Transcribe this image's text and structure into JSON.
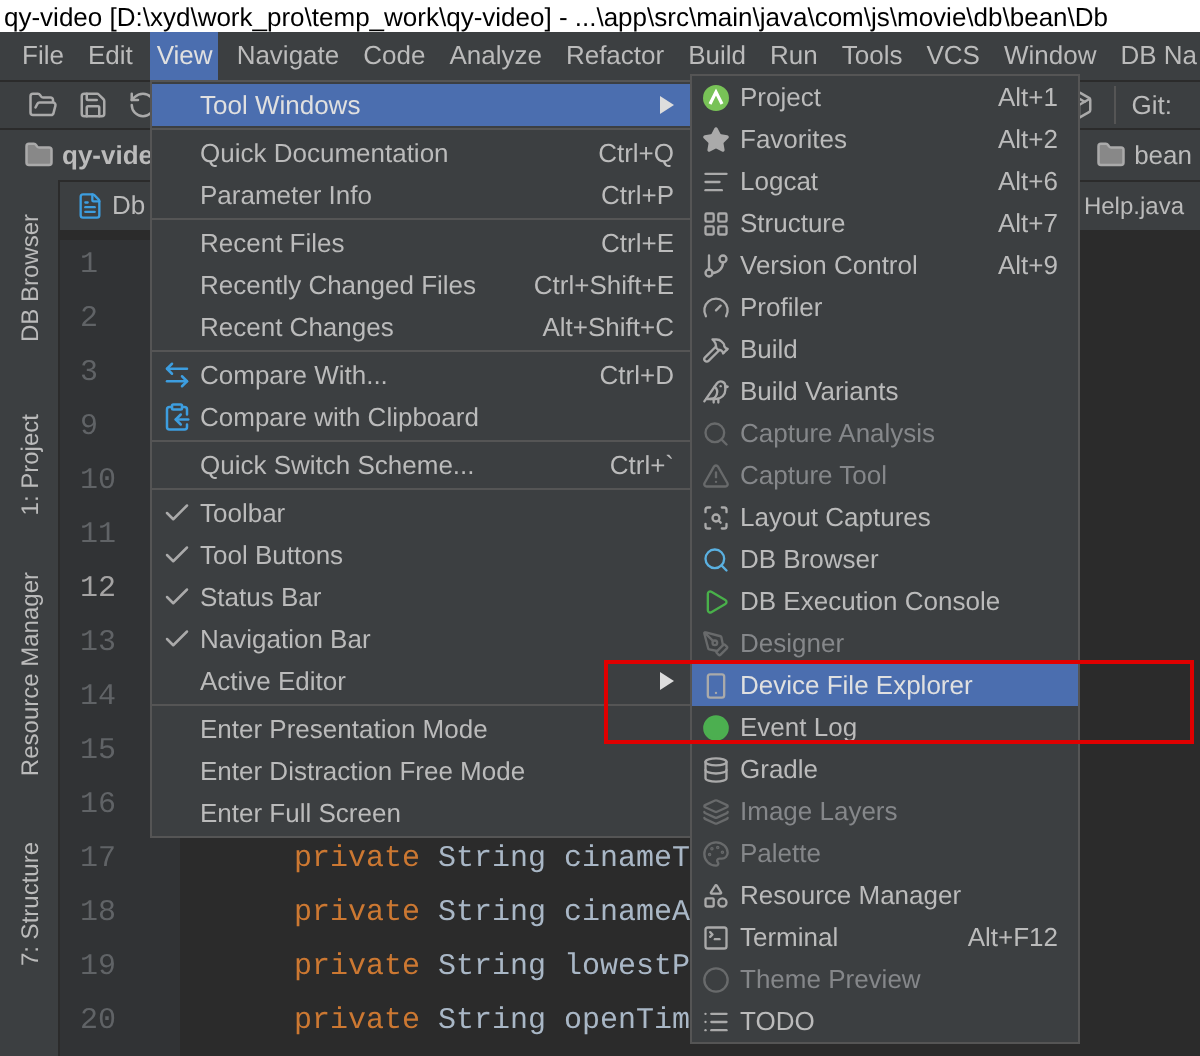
{
  "window": {
    "title": "qy-video [D:\\xyd\\work_pro\\temp_work\\qy-video] - ...\\app\\src\\main\\java\\com\\js\\movie\\db\\bean\\Db"
  },
  "menubar": [
    {
      "label": "File",
      "selected": false
    },
    {
      "label": "Edit",
      "selected": false
    },
    {
      "label": "View",
      "selected": true
    },
    {
      "label": "Navigate",
      "selected": false
    },
    {
      "label": "Code",
      "selected": false
    },
    {
      "label": "Analyze",
      "selected": false
    },
    {
      "label": "Refactor",
      "selected": false
    },
    {
      "label": "Build",
      "selected": false
    },
    {
      "label": "Run",
      "selected": false
    },
    {
      "label": "Tools",
      "selected": false
    },
    {
      "label": "VCS",
      "selected": false
    },
    {
      "label": "Window",
      "selected": false
    },
    {
      "label": "DB Na",
      "selected": false
    }
  ],
  "toolbar": {
    "git_label": "Git:"
  },
  "navbar": {
    "project": "qy-vide",
    "folder": "bean"
  },
  "editor_tabs": [
    {
      "label": "Db"
    },
    {
      "label": "Help.java"
    }
  ],
  "tool_strip": [
    {
      "label": "DB Browser"
    },
    {
      "label": "1: Project"
    },
    {
      "label": "Resource Manager"
    },
    {
      "label": "7: Structure"
    }
  ],
  "editor": {
    "lines": [
      {
        "number": "1",
        "current": false
      },
      {
        "number": "2",
        "current": false
      },
      {
        "number": "3",
        "current": false
      },
      {
        "number": "9",
        "current": false
      },
      {
        "number": "10",
        "current": false
      },
      {
        "number": "11",
        "current": false
      },
      {
        "number": "12",
        "current": true
      },
      {
        "number": "13",
        "current": false
      },
      {
        "number": "14",
        "current": false
      },
      {
        "number": "15",
        "current": false
      },
      {
        "number": "16",
        "current": false
      },
      {
        "number": "17",
        "current": false,
        "keyword": "private",
        "code": "String cinameT"
      },
      {
        "number": "18",
        "current": false,
        "keyword": "private",
        "code": "String cinameA"
      },
      {
        "number": "19",
        "current": false,
        "keyword": "private",
        "code": "String lowestP"
      },
      {
        "number": "20",
        "current": false,
        "keyword": "private",
        "code": "String openTim"
      }
    ]
  },
  "view_menu": {
    "items": [
      {
        "kind": "item",
        "label": "Tool Windows",
        "submenu": true,
        "selected": true,
        "checked": false
      },
      {
        "kind": "separator"
      },
      {
        "kind": "item",
        "label": "Quick Documentation",
        "shortcut": "Ctrl+Q",
        "submenu": false,
        "selected": false,
        "checked": false
      },
      {
        "kind": "item",
        "label": "Parameter Info",
        "shortcut": "Ctrl+P",
        "submenu": false,
        "selected": false,
        "checked": false
      },
      {
        "kind": "separator"
      },
      {
        "kind": "item",
        "label": "Recent Files",
        "shortcut": "Ctrl+E",
        "submenu": false,
        "selected": false,
        "checked": false
      },
      {
        "kind": "item",
        "label": "Recently Changed Files",
        "shortcut": "Ctrl+Shift+E",
        "submenu": false,
        "selected": false,
        "checked": false
      },
      {
        "kind": "item",
        "label": "Recent Changes",
        "shortcut": "Alt+Shift+C",
        "submenu": false,
        "selected": false,
        "checked": false
      },
      {
        "kind": "separator"
      },
      {
        "kind": "item",
        "label": "Compare With...",
        "shortcut": "Ctrl+D",
        "submenu": false,
        "selected": false,
        "checked": false
      },
      {
        "kind": "item",
        "label": "Compare with Clipboard",
        "submenu": false,
        "selected": false,
        "checked": false
      },
      {
        "kind": "separator"
      },
      {
        "kind": "item",
        "label": "Quick Switch Scheme...",
        "shortcut": "Ctrl+`",
        "submenu": false,
        "selected": false,
        "checked": false
      },
      {
        "kind": "separator"
      },
      {
        "kind": "item",
        "label": "Toolbar",
        "submenu": false,
        "selected": false,
        "checked": true
      },
      {
        "kind": "item",
        "label": "Tool Buttons",
        "submenu": false,
        "selected": false,
        "checked": true
      },
      {
        "kind": "item",
        "label": "Status Bar",
        "submenu": false,
        "selected": false,
        "checked": true
      },
      {
        "kind": "item",
        "label": "Navigation Bar",
        "submenu": false,
        "selected": false,
        "checked": true
      },
      {
        "kind": "item",
        "label": "Active Editor",
        "submenu": true,
        "selected": false,
        "checked": false
      },
      {
        "kind": "separator"
      },
      {
        "kind": "item",
        "label": "Enter Presentation Mode",
        "submenu": false,
        "selected": false,
        "checked": false
      },
      {
        "kind": "item",
        "label": "Enter Distraction Free Mode",
        "submenu": false,
        "selected": false,
        "checked": false
      },
      {
        "kind": "item",
        "label": "Enter Full Screen",
        "submenu": false,
        "selected": false,
        "checked": false
      }
    ]
  },
  "tool_windows_menu": {
    "items": [
      {
        "label": "Project",
        "shortcut": "Alt+1",
        "disabled": false,
        "selected": false
      },
      {
        "label": "Favorites",
        "shortcut": "Alt+2",
        "disabled": false,
        "selected": false
      },
      {
        "label": "Logcat",
        "shortcut": "Alt+6",
        "disabled": false,
        "selected": false
      },
      {
        "label": "Structure",
        "shortcut": "Alt+7",
        "disabled": false,
        "selected": false
      },
      {
        "label": "Version Control",
        "shortcut": "Alt+9",
        "disabled": false,
        "selected": false
      },
      {
        "label": "Profiler",
        "disabled": false,
        "selected": false
      },
      {
        "label": "Build",
        "disabled": false,
        "selected": false
      },
      {
        "label": "Build Variants",
        "disabled": false,
        "selected": false
      },
      {
        "label": "Capture Analysis",
        "disabled": true,
        "selected": false
      },
      {
        "label": "Capture Tool",
        "disabled": true,
        "selected": false
      },
      {
        "label": "Layout Captures",
        "disabled": false,
        "selected": false
      },
      {
        "label": "DB Browser",
        "disabled": false,
        "selected": false
      },
      {
        "label": "DB Execution Console",
        "disabled": false,
        "selected": false
      },
      {
        "label": "Designer",
        "disabled": true,
        "selected": false
      },
      {
        "label": "Device File Explorer",
        "disabled": false,
        "selected": true
      },
      {
        "label": "Event Log",
        "disabled": false,
        "selected": false
      },
      {
        "label": "Gradle",
        "disabled": false,
        "selected": false
      },
      {
        "label": "Image Layers",
        "disabled": true,
        "selected": false
      },
      {
        "label": "Palette",
        "disabled": true,
        "selected": false
      },
      {
        "label": "Resource Manager",
        "disabled": false,
        "selected": false
      },
      {
        "label": "Terminal",
        "shortcut": "Alt+F12",
        "disabled": false,
        "selected": false
      },
      {
        "label": "Theme Preview",
        "disabled": true,
        "selected": false
      },
      {
        "label": "TODO",
        "disabled": false,
        "selected": false
      }
    ]
  }
}
